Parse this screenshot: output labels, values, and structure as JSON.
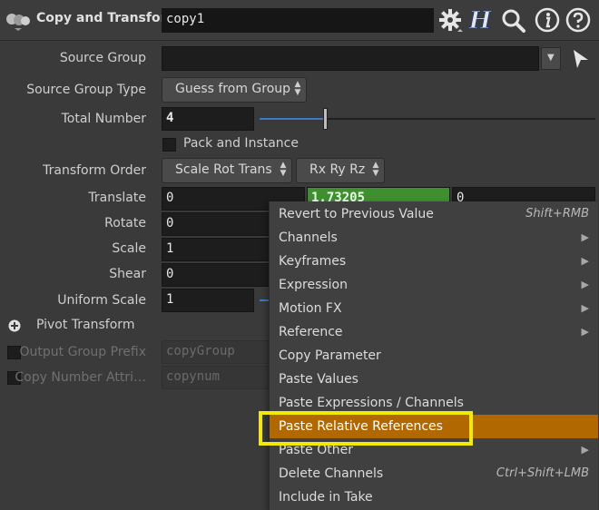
{
  "header": {
    "node_type": "Copy and Transform",
    "node_name": "copy1",
    "help_letter": "H"
  },
  "params": {
    "source_group": {
      "label": "Source Group",
      "value": ""
    },
    "source_group_type": {
      "label": "Source Group Type",
      "value": "Guess from Group"
    },
    "total_number": {
      "label": "Total Number",
      "value": "4",
      "slider_fraction": 0.2
    },
    "pack_and_instance": {
      "label": "Pack and Instance",
      "checked": false
    },
    "transform_order": {
      "label": "Transform Order",
      "value": "Scale Rot Trans",
      "rot_order": "Rx Ry Rz"
    },
    "translate": {
      "label": "Translate",
      "x": "0",
      "y": "1.73205",
      "z": "0"
    },
    "rotate": {
      "label": "Rotate",
      "x": "0"
    },
    "scale": {
      "label": "Scale",
      "x": "1"
    },
    "shear": {
      "label": "Shear",
      "x": "0"
    },
    "uniform_scale": {
      "label": "Uniform Scale",
      "value": "1"
    },
    "pivot_transform": {
      "label": "Pivot Transform"
    },
    "output_group_prefix": {
      "label": "Output Group Prefix",
      "value": "copyGroup"
    },
    "copy_number_attrib": {
      "label": "Copy Number Attri…",
      "value": "copynum"
    }
  },
  "context_menu": {
    "items": [
      {
        "label": "Revert to Previous Value",
        "shortcut": "Shift+RMB"
      },
      {
        "label": "Channels",
        "submenu": true
      },
      {
        "label": "Keyframes",
        "submenu": true
      },
      {
        "label": "Expression",
        "submenu": true
      },
      {
        "label": "Motion FX",
        "submenu": true
      },
      {
        "label": "Reference",
        "submenu": true
      },
      {
        "label": "Copy Parameter"
      },
      {
        "label": "Paste Values"
      },
      {
        "label": "Paste Expressions / Channels"
      },
      {
        "label": "Paste Relative References",
        "highlighted": true
      },
      {
        "label": "Paste Other",
        "submenu": true
      },
      {
        "label": "Delete Channels",
        "shortcut": "Ctrl+Shift+LMB"
      },
      {
        "label": "Include in Take"
      }
    ]
  },
  "colors": {
    "highlight": "#b26800",
    "annotation_box": "#f2ea00",
    "animated_field": "#3f8f2f"
  },
  "icons": [
    "node-icon",
    "gear-icon",
    "help-h-icon",
    "search-icon",
    "info-icon",
    "question-icon",
    "arrow-pointer-icon",
    "plus-icon"
  ]
}
